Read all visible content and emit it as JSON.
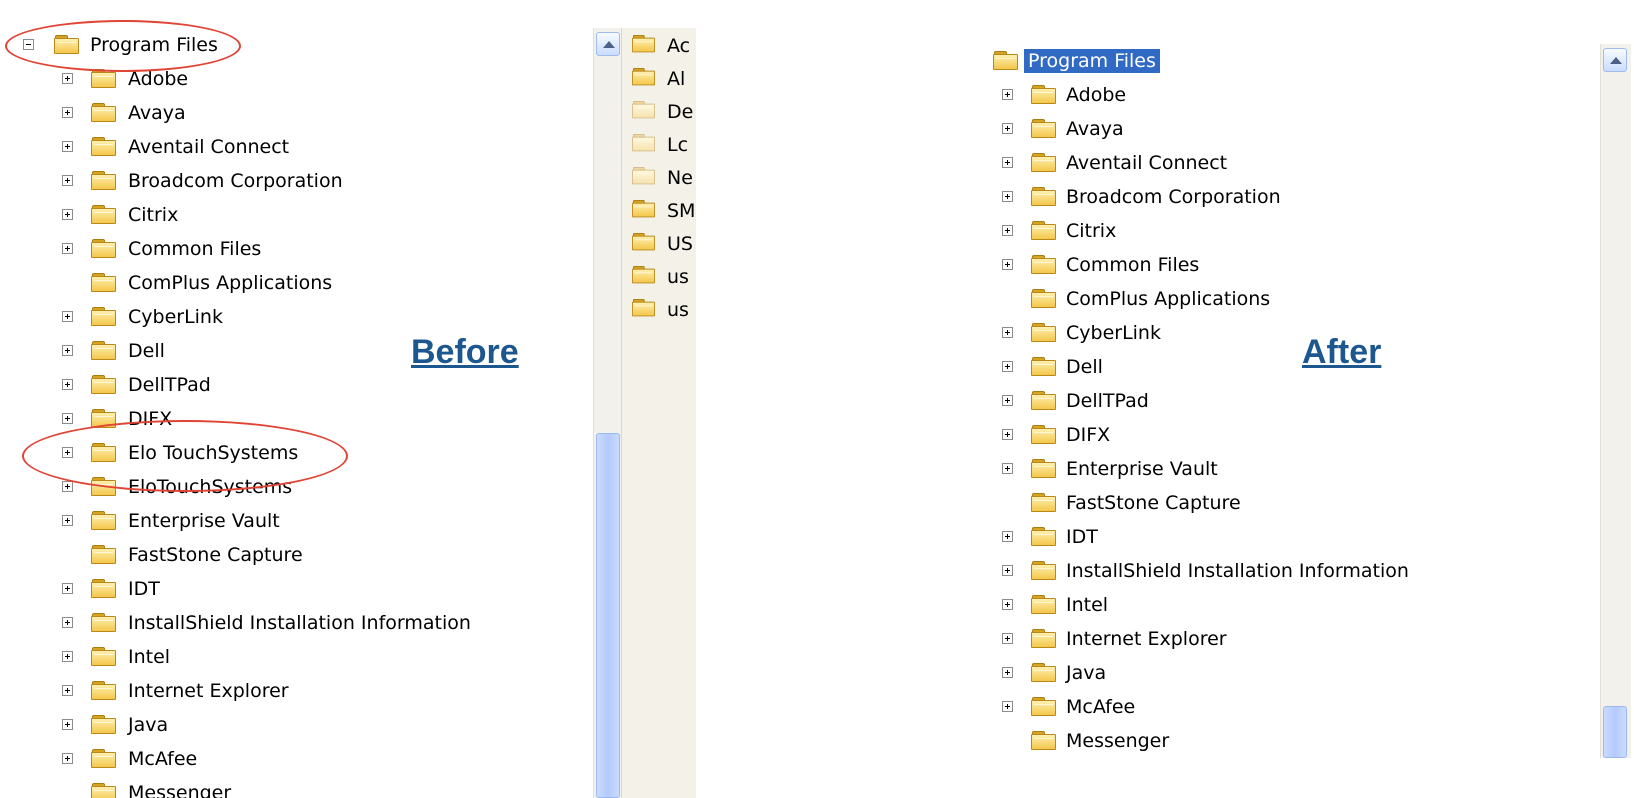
{
  "captions": {
    "before": "Before",
    "after": "After"
  },
  "before_tree": {
    "root": "Program Files",
    "children": [
      {
        "label": "Adobe",
        "expandable": true
      },
      {
        "label": "Avaya",
        "expandable": true
      },
      {
        "label": "Aventail Connect",
        "expandable": true
      },
      {
        "label": "Broadcom Corporation",
        "expandable": true
      },
      {
        "label": "Citrix",
        "expandable": true
      },
      {
        "label": "Common Files",
        "expandable": true
      },
      {
        "label": "ComPlus Applications",
        "expandable": false
      },
      {
        "label": "CyberLink",
        "expandable": true
      },
      {
        "label": "Dell",
        "expandable": true
      },
      {
        "label": "DellTPad",
        "expandable": true
      },
      {
        "label": "DIFX",
        "expandable": true
      },
      {
        "label": "Elo TouchSystems",
        "expandable": true
      },
      {
        "label": "EloTouchSystems",
        "expandable": true
      },
      {
        "label": "Enterprise Vault",
        "expandable": true
      },
      {
        "label": "FastStone Capture",
        "expandable": false
      },
      {
        "label": "IDT",
        "expandable": true
      },
      {
        "label": "InstallShield Installation Information",
        "expandable": true
      },
      {
        "label": "Intel",
        "expandable": true
      },
      {
        "label": "Internet Explorer",
        "expandable": true
      },
      {
        "label": "Java",
        "expandable": true
      },
      {
        "label": "McAfee",
        "expandable": true
      },
      {
        "label": "Messenger",
        "expandable": false
      }
    ]
  },
  "after_tree": {
    "root": "Program Files",
    "children": [
      {
        "label": "Adobe",
        "expandable": true
      },
      {
        "label": "Avaya",
        "expandable": true
      },
      {
        "label": "Aventail Connect",
        "expandable": true
      },
      {
        "label": "Broadcom Corporation",
        "expandable": true
      },
      {
        "label": "Citrix",
        "expandable": true
      },
      {
        "label": "Common Files",
        "expandable": true
      },
      {
        "label": "ComPlus Applications",
        "expandable": false
      },
      {
        "label": "CyberLink",
        "expandable": true
      },
      {
        "label": "Dell",
        "expandable": true
      },
      {
        "label": "DellTPad",
        "expandable": true
      },
      {
        "label": "DIFX",
        "expandable": true
      },
      {
        "label": "Enterprise Vault",
        "expandable": true
      },
      {
        "label": "FastStone Capture",
        "expandable": false
      },
      {
        "label": "IDT",
        "expandable": true
      },
      {
        "label": "InstallShield Installation Information",
        "expandable": true
      },
      {
        "label": "Intel",
        "expandable": true
      },
      {
        "label": "Internet Explorer",
        "expandable": true
      },
      {
        "label": "Java",
        "expandable": true
      },
      {
        "label": "McAfee",
        "expandable": true
      },
      {
        "label": "Messenger",
        "expandable": false
      }
    ]
  },
  "file_pane": [
    {
      "label": "Ac",
      "pale": false
    },
    {
      "label": "Al",
      "pale": false
    },
    {
      "label": "De",
      "pale": true
    },
    {
      "label": "Lc",
      "pale": true
    },
    {
      "label": "Ne",
      "pale": true
    },
    {
      "label": "SM",
      "pale": false
    },
    {
      "label": "US",
      "pale": false
    },
    {
      "label": "us",
      "pale": false
    },
    {
      "label": "us",
      "pale": false
    }
  ],
  "colors": {
    "selection": "#316ac5",
    "caption": "#1c578f",
    "highlight_circle": "#e04434"
  }
}
